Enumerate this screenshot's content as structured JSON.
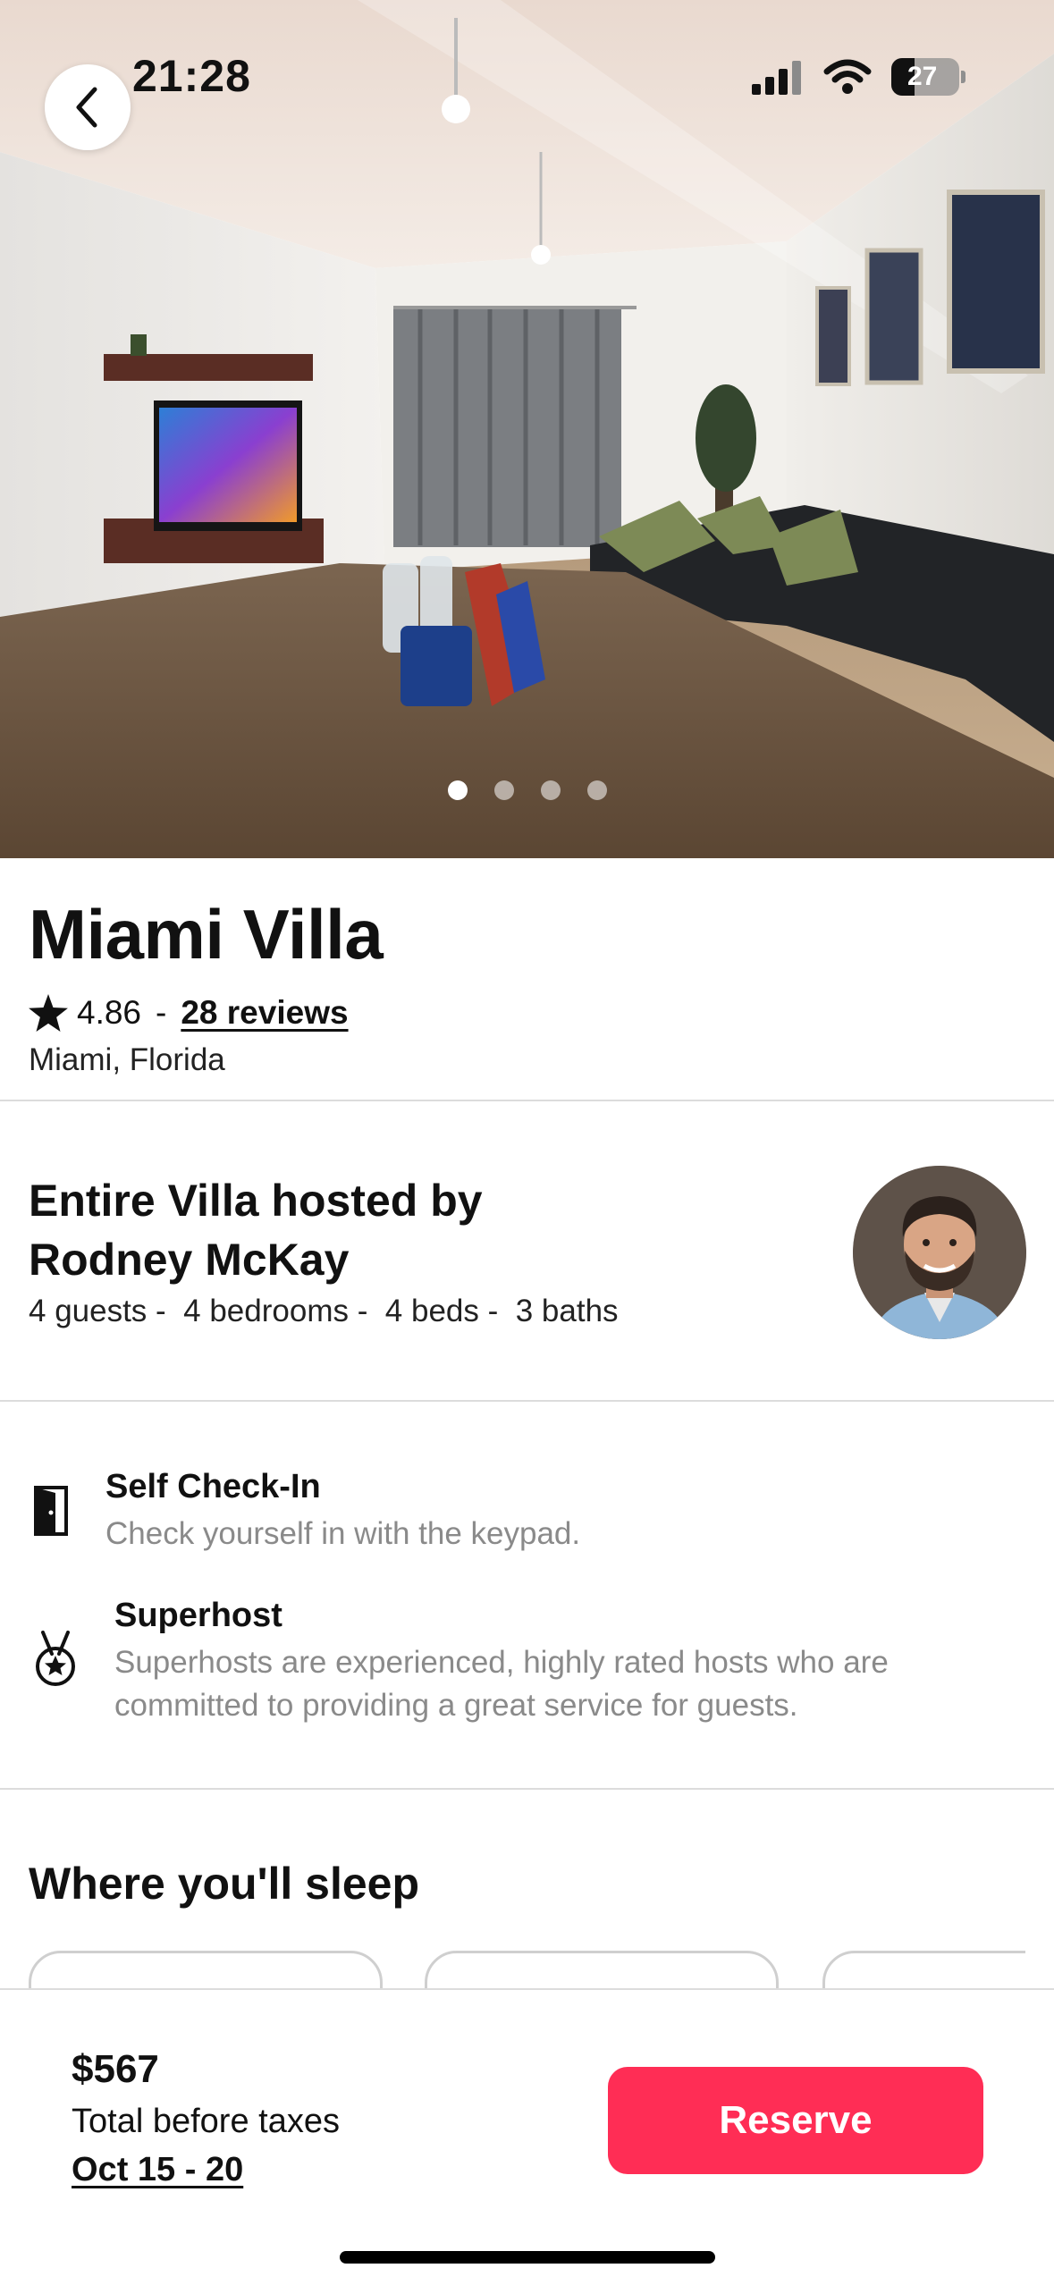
{
  "status_bar": {
    "time": "21:28",
    "battery_level": "27"
  },
  "gallery": {
    "image_count": 4,
    "active_index": 0
  },
  "listing": {
    "title": "Miami Villa",
    "rating": "4.86",
    "separator": "-",
    "reviews_label": "28 reviews",
    "location": "Miami, Florida"
  },
  "host": {
    "summary_line1": "Entire Villa hosted by",
    "summary_line2": "Rodney McKay",
    "details": [
      "4 guests - ",
      " 4 bedrooms - ",
      " 4 beds - ",
      " 3 baths"
    ]
  },
  "highlights": [
    {
      "icon": "door-icon",
      "title": "Self Check-In",
      "description": "Check yourself in with the keypad."
    },
    {
      "icon": "medal-icon",
      "title": "Superhost",
      "description_line1": "Superhosts are experienced, highly rated hosts who are",
      "description_line2": "committed to providing a great service for guests."
    }
  ],
  "sleep": {
    "title": "Where you'll sleep"
  },
  "booking": {
    "price": "$567",
    "price_note": "Total before taxes",
    "dates": "Oct 15 - 20",
    "reserve_label": "Reserve"
  },
  "colors": {
    "accent": "#ff2d55",
    "divider": "#dcdcdc",
    "muted_text": "#8a8a8a"
  }
}
